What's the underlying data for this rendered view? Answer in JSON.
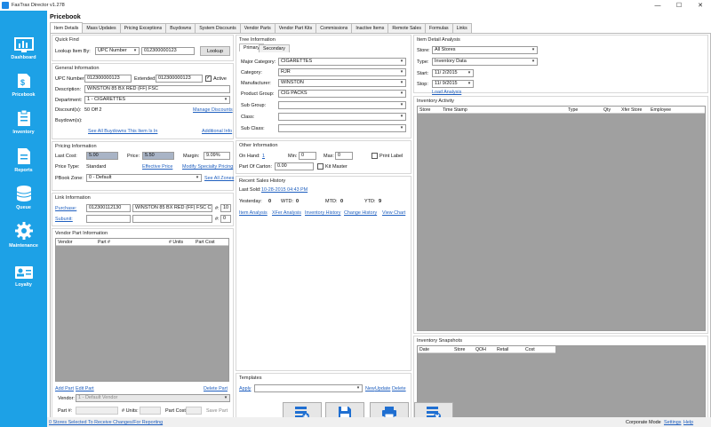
{
  "window": {
    "title": "FasTrax Director v1.278",
    "minimize": "—",
    "maximize": "☐",
    "close": "✕"
  },
  "sidebar": {
    "items": [
      {
        "label": "Dashboard",
        "icon": "dashboard-icon"
      },
      {
        "label": "Pricebook",
        "icon": "pricebook-icon"
      },
      {
        "label": "Inventory",
        "icon": "inventory-icon"
      },
      {
        "label": "Reports",
        "icon": "reports-icon"
      },
      {
        "label": "Queue",
        "icon": "queue-icon"
      },
      {
        "label": "Maintenance",
        "icon": "gear-icon"
      },
      {
        "label": "Loyalty",
        "icon": "loyalty-icon"
      }
    ]
  },
  "page": {
    "title": "Pricebook"
  },
  "tabs": [
    "Item Details",
    "Mass Updates",
    "Pricing Exceptions",
    "Buydowns",
    "System Discounts",
    "Vendor Parts",
    "Vendor Part Kits",
    "Commissions",
    "Inactive Items",
    "Remote Sales",
    "Formulas",
    "Links"
  ],
  "quickfind": {
    "title": "Quick Find",
    "lookup_by_label": "Lookup Item By:",
    "lookup_by_value": "UPC Number",
    "lookup_value": "012300000123",
    "lookup_button": "Lookup"
  },
  "general": {
    "title": "General Information",
    "upc_label": "UPC Number:",
    "upc_value": "012300000123",
    "extended_label": "Extended:",
    "extended_value": "012300000123",
    "active_label": "Active",
    "description_label": "Description:",
    "description_value": "WINSTON 85 BX RED (FF) FSC",
    "department_label": "Department:",
    "department_value": "1 - CIGARETTES",
    "discounts_label": "Discount(s):",
    "discounts_value": "50 Off 2",
    "manage_discounts": "Manage Discounts",
    "buydowns_label": "Buydown(s):",
    "see_all_buydowns": "See All Buydowns This Item Is In",
    "additional_info": "Additional Info"
  },
  "pricing": {
    "title": "Pricing Information",
    "last_cost_label": "Last Cost:",
    "last_cost_value": "5.00",
    "price_label": "Price:",
    "price_value": "5.50",
    "margin_label": "Margin:",
    "margin_value": "9.09%",
    "price_type_label": "Price Type:",
    "price_type_value": "Standard",
    "effective_price": "Effective Price",
    "modify_specialty": "Modify Specialty Pricing",
    "pbook_zone_label": "PBook Zone:",
    "pbook_zone_value": "0 - Default",
    "see_all_zones": "See All Zones"
  },
  "link": {
    "title": "Link Information",
    "purchase_label": "Purchase:",
    "purchase_upc": "012300112130",
    "purchase_desc": "WINSTON 85 BX RED (FF) FSC CT",
    "purchase_num_label": "#:",
    "purchase_num": "10",
    "subunit_label": "Subunit:",
    "subunit_num_label": "#:",
    "subunit_num": "0"
  },
  "vendor": {
    "title": "Vendor Part Information",
    "columns": [
      "Vendor",
      "Part #",
      "# Units",
      "Part Cost"
    ],
    "add_part": "Add Part",
    "edit_part": "Edit Part",
    "delete_part": "Delete Part",
    "vendor_label": "Vendor:",
    "vendor_value": "1 - Default Vendor",
    "part_label": "Part #:",
    "units_label": "# Units:",
    "cost_label": "Part Cost:",
    "save_part": "Save Part"
  },
  "tree": {
    "title": "Tree Information",
    "tab_primary": "Primary",
    "tab_secondary": "Secondary",
    "major_label": "Major Category:",
    "major_value": "CIGARETTES",
    "category_label": "Category:",
    "category_value": "RJR",
    "manufacturer_label": "Manufacturer:",
    "manufacturer_value": "WINSTON",
    "product_group_label": "Product Group:",
    "product_group_value": "CIG PACKS",
    "sub_group_label": "Sub Group:",
    "class_label": "Class:",
    "sub_class_label": "Sub Class:"
  },
  "other": {
    "title": "Other Information",
    "on_hand_label": "On Hand:",
    "on_hand_value": "1",
    "min_label": "Min:",
    "min_value": "0",
    "max_label": "Max:",
    "max_value": "0",
    "print_label": "Print Label",
    "part_carton_label": "Part Of Carton:",
    "part_carton_value": "0.00",
    "kit_master": "Kit Master"
  },
  "sales": {
    "title": "Recent Sales History",
    "last_sold_label": "Last Sold:",
    "last_sold_value": "10-28-2015 04:43 PM",
    "yesterday_label": "Yesterday:",
    "yesterday_value": "0",
    "wtd_label": "WTD:",
    "wtd_value": "0",
    "mtd_label": "MTD:",
    "mtd_value": "0",
    "ytd_label": "YTD:",
    "ytd_value": "9",
    "links": [
      "Item Analysis",
      "XFer Analysis",
      "Inventory History",
      "Change History",
      "View Chart"
    ]
  },
  "templates": {
    "title": "Templates",
    "apply": "Apply",
    "new": "New",
    "update": "Update",
    "delete": "Delete"
  },
  "analysis": {
    "title": "Item Detail Analysis",
    "store_label": "Store:",
    "store_value": "All Stores",
    "type_label": "Type:",
    "type_value": "Inventory Data",
    "start_label": "Start:",
    "start_value": "11/ 2/2015",
    "stop_label": "Stop:",
    "stop_value": "11/ 9/2015",
    "load_analysis": "Load Analysis"
  },
  "activity": {
    "title": "Inventory Activity",
    "columns": [
      "Store",
      "Time Stamp",
      "Type",
      "Qty",
      "Xfer Store",
      "Employee"
    ]
  },
  "snapshots": {
    "title": "Inventory Snapshots",
    "columns": [
      "Date",
      "Store",
      "QOH",
      "Retail",
      "Cost"
    ]
  },
  "status": {
    "stores_selected": "0 Stores Selected To Receive Changes/For Reporting",
    "mode": "Corporate Mode",
    "settings": "Settings",
    "help": "Help"
  }
}
